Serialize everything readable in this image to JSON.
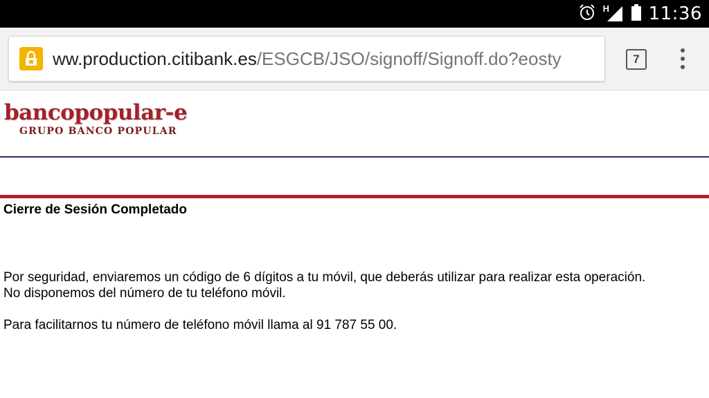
{
  "status_bar": {
    "time": "11:36",
    "network": "H",
    "icons": [
      "alarm-icon",
      "signal-icon",
      "battery-icon"
    ]
  },
  "browser": {
    "url_host": "ww.production.citibank.es",
    "url_path": "/ESGCB/JSO/signoff/Signoff.do?eosty",
    "tab_count": "7",
    "lock_color": "#f4b400"
  },
  "page": {
    "logo_main": "bancopopular-e",
    "logo_sub": "GRUPO BANCO POPULAR",
    "title": "Cierre de Sesión Completado",
    "paragraph1_line1": "Por seguridad, enviaremos un código de 6 dígitos a tu móvil, que deberás utilizar para realizar esta operación.",
    "paragraph1_line2": "No disponemos del número de tu teléfono móvil.",
    "paragraph2": "Para facilitarnos tu número de teléfono móvil llama al 91 787 55 00.",
    "colors": {
      "brand_red": "#a2222c",
      "rule_red": "#b3202e",
      "rule_navy": "#1f2a6e"
    }
  }
}
